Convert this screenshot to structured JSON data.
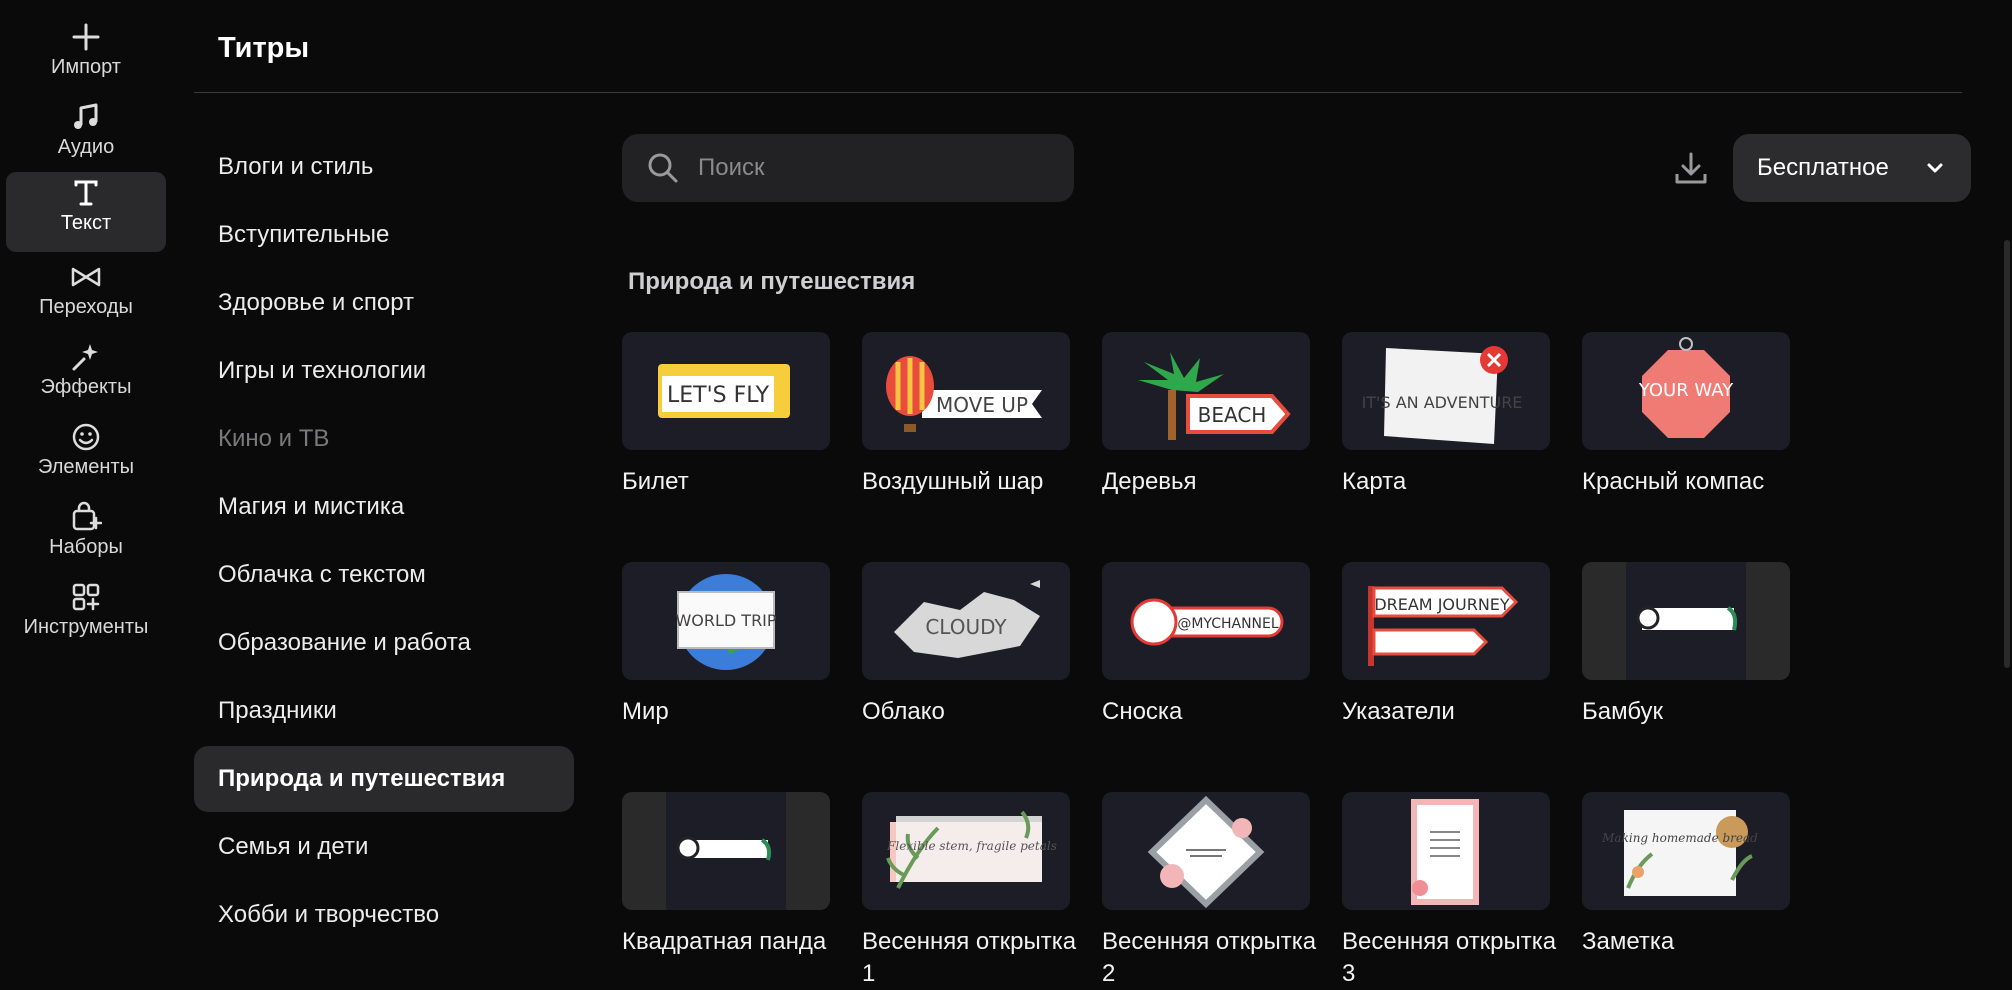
{
  "rail": [
    {
      "label": "Импорт",
      "icon": "plus-icon"
    },
    {
      "label": "Аудио",
      "icon": "music-note-icon"
    },
    {
      "label": "Текст",
      "icon": "text-icon",
      "active": true
    },
    {
      "label": "Переходы",
      "icon": "bowtie-transition-icon"
    },
    {
      "label": "Эффекты",
      "icon": "sparkle-icon"
    },
    {
      "label": "Элементы",
      "icon": "smiley-icon"
    },
    {
      "label": "Наборы",
      "icon": "bag-plus-icon"
    },
    {
      "label": "Инструменты",
      "icon": "grid-plus-icon"
    }
  ],
  "header": {
    "title": "Титры"
  },
  "categories": [
    {
      "label": "Влоги и стиль"
    },
    {
      "label": "Вступительные"
    },
    {
      "label": "Здоровье и спорт"
    },
    {
      "label": "Игры и технологии"
    },
    {
      "label": "Кино и ТВ",
      "dimmed": true
    },
    {
      "label": "Магия и мистика"
    },
    {
      "label": "Облачка с текстом"
    },
    {
      "label": "Образование и работа"
    },
    {
      "label": "Праздники"
    },
    {
      "label": "Природа и путешествия",
      "active": true
    },
    {
      "label": "Семья и дети"
    },
    {
      "label": "Хобби и творчество"
    }
  ],
  "search": {
    "placeholder": "Поиск",
    "value": ""
  },
  "price_filter": {
    "selected": "Бесплатное"
  },
  "section": {
    "title": "Природа и путешествия"
  },
  "items": [
    {
      "label": "Билет",
      "thumb_text": "LET'S FLY"
    },
    {
      "label": "Воздушный шар",
      "thumb_text": "MOVE UP"
    },
    {
      "label": "Деревья",
      "thumb_text": "BEACH"
    },
    {
      "label": "Карта",
      "thumb_text": "IT'S AN ADVENTURE"
    },
    {
      "label": "Красный компас",
      "thumb_text": "YOUR WAY"
    },
    {
      "label": "Мир",
      "thumb_text": "WORLD TRIP"
    },
    {
      "label": "Облако",
      "thumb_text": "CLOUDY"
    },
    {
      "label": "Сноска",
      "thumb_text": "@MYCHANNEL"
    },
    {
      "label": "Указатели",
      "thumb_text": "DREAM JOURNEY"
    },
    {
      "label": "Бамбук",
      "thumb_text": ""
    },
    {
      "label": "Квадратная панда",
      "thumb_text": ""
    },
    {
      "label": "Весенняя открытка 1",
      "thumb_text": "Flexible stem, fragile petals"
    },
    {
      "label": "Весенняя открытка 2",
      "thumb_text": ""
    },
    {
      "label": "Весенняя открытка 3",
      "thumb_text": ""
    },
    {
      "label": "Заметка",
      "thumb_text": "Making homemade bread"
    }
  ]
}
